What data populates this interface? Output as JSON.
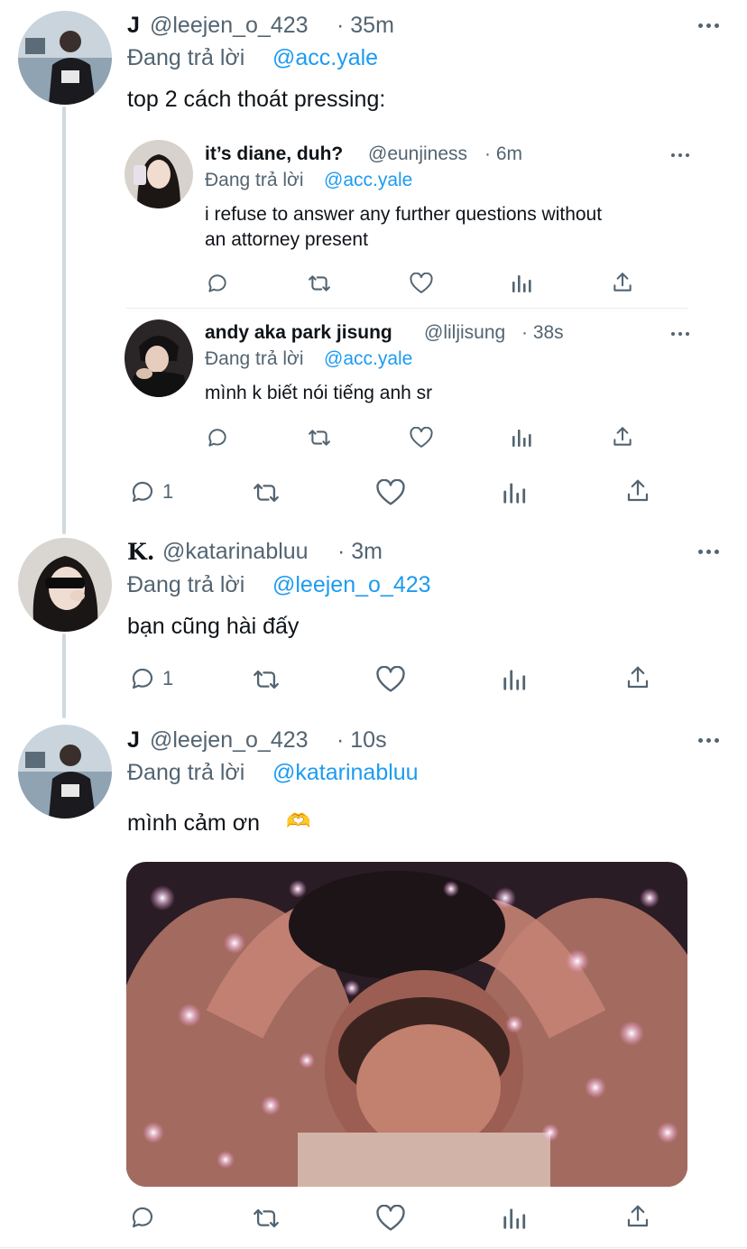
{
  "tweet1": {
    "name": "J",
    "handle": "@leejen_o_423",
    "time": "· 35m",
    "reply_prefix": "Đang trả lời",
    "reply_to": "@acc.yale",
    "text": "top 2 cách thoát pressing:"
  },
  "quoted": [
    {
      "name": "it’s diane, duh?",
      "handle": "@eunjiness",
      "time": "· 6m",
      "reply_prefix": "Đang trả lời",
      "reply_to": "@acc.yale",
      "text_line1": "i refuse to answer any further questions without",
      "text_line2": "an attorney present"
    },
    {
      "name": "andy aka park jisung",
      "handle": "@liljisung",
      "time": "· 38s",
      "reply_prefix": "Đang trả lời",
      "reply_to": "@acc.yale",
      "text_line1": "mình k biết nói tiếng anh sr"
    }
  ],
  "tweet1_actions": {
    "reply_count": "1"
  },
  "tweet2": {
    "name": "K.",
    "handle": "@katarinabluu",
    "time": "· 3m",
    "reply_prefix": "Đang trả lời",
    "reply_to": "@leejen_o_423",
    "text": "bạn cũng hài đấy",
    "reply_count": "1"
  },
  "tweet3": {
    "name": "J",
    "handle": "@leejen_o_423",
    "time": "· 10s",
    "reply_prefix": "Đang trả lời",
    "reply_to": "@katarinabluu",
    "text": "mình cảm ơn",
    "emoji": "🫶"
  },
  "icons": {
    "reply": "reply-icon",
    "retweet": "retweet-icon",
    "like": "heart-icon",
    "views": "views-icon",
    "share": "share-icon",
    "more": "more-icon"
  },
  "colors": {
    "link": "#1d9bf0",
    "muted": "#536471",
    "thread_line": "#cfd9de"
  }
}
